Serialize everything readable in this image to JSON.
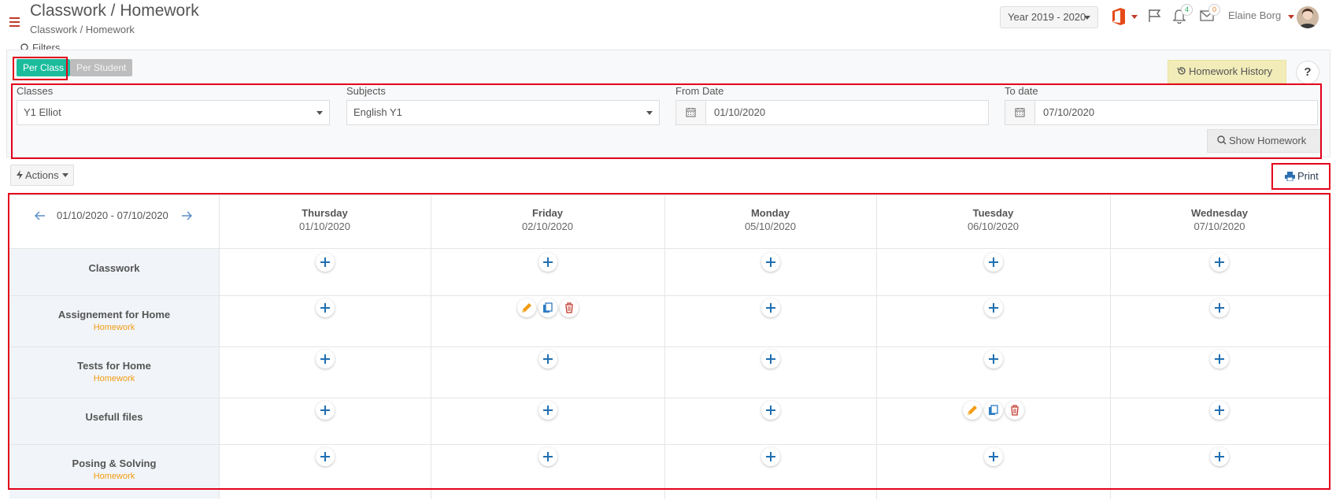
{
  "header": {
    "title": "Classwork / Homework",
    "breadcrumb": "Classwork / Homework",
    "year_select": "Year 2019 - 2020",
    "notifications_count": "4",
    "messages_count": "0",
    "user_name": "Elaine Borg"
  },
  "filters": {
    "label": "Filters",
    "per_class": "Per Class",
    "per_student": "Per Student",
    "homework_history": "Homework History",
    "help": "?",
    "classes_label": "Classes",
    "classes_value": "Y1 Elliot",
    "subjects_label": "Subjects",
    "subjects_value": "English Y1",
    "from_label": "From Date",
    "from_value": "01/10/2020",
    "to_label": "To date",
    "to_value": "07/10/2020",
    "show_homework": "Show Homework"
  },
  "toolbar": {
    "actions": "Actions",
    "print": "Print"
  },
  "grid": {
    "range": "01/10/2020 - 07/10/2020",
    "days": [
      {
        "name": "Thursday",
        "date": "01/10/2020"
      },
      {
        "name": "Friday",
        "date": "02/10/2020"
      },
      {
        "name": "Monday",
        "date": "05/10/2020"
      },
      {
        "name": "Tuesday",
        "date": "06/10/2020"
      },
      {
        "name": "Wednesday",
        "date": "07/10/2020"
      }
    ],
    "rows": [
      {
        "label": "Classwork",
        "sub": ""
      },
      {
        "label": "Assignement for Home",
        "sub": "Homework"
      },
      {
        "label": "Tests for Home",
        "sub": "Homework"
      },
      {
        "label": "Usefull files",
        "sub": ""
      },
      {
        "label": "Posing & Solving",
        "sub": "Homework"
      }
    ]
  },
  "colors": {
    "accent_green": "#1abc9c",
    "plus_blue": "#1f6fb2",
    "edit_orange": "#f39c12",
    "delete_red": "#c0392b",
    "annotation_red": "#e3001b"
  }
}
